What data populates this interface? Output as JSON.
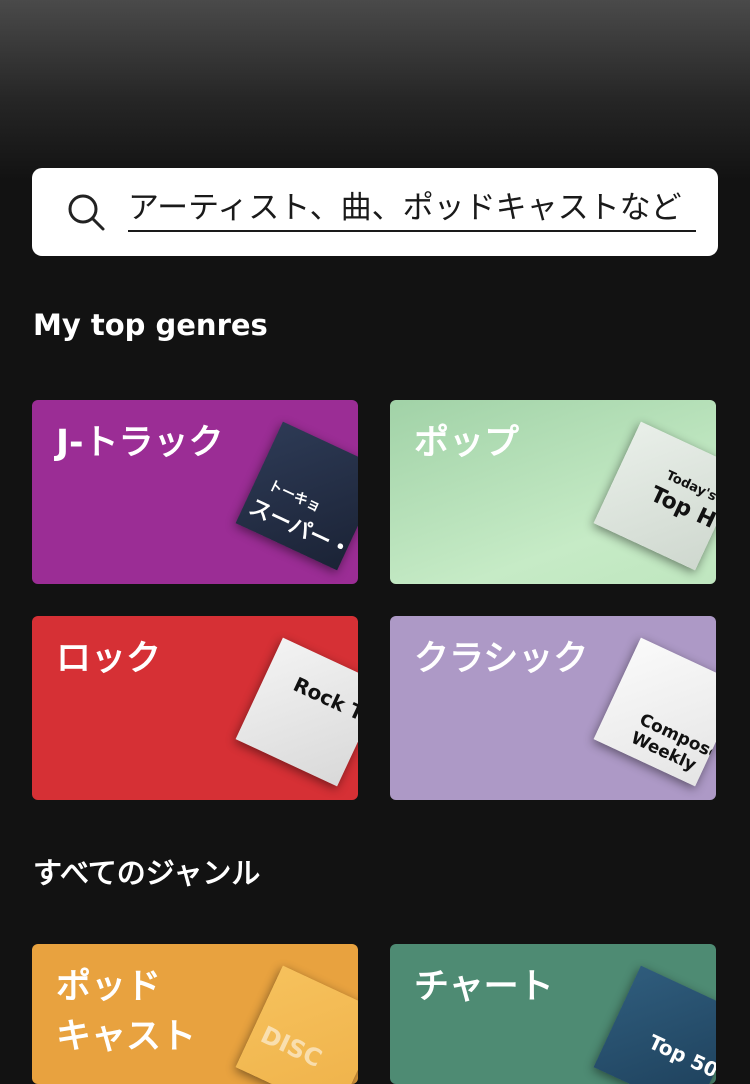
{
  "search": {
    "placeholder": "アーティスト、曲、ポッドキャストなど"
  },
  "sections": {
    "top_genres_title": "My top genres",
    "all_genres_title": "すべてのジャンル"
  },
  "top_genres": [
    {
      "label": "J-トラック",
      "color": "#9b2d95",
      "cover_text_1": "トーキョ",
      "cover_text_2": "スーパー・ヒ"
    },
    {
      "label": "ポップ",
      "color": "#a6d7ad",
      "cover_text_1": "Today's",
      "cover_text_2": "Top H"
    },
    {
      "label": "ロック",
      "color": "#d63035",
      "cover_text_1": "Rock T"
    },
    {
      "label": "クラシック",
      "color": "#ad99c6",
      "cover_text_1": "Composer",
      "cover_text_2": "Weekly"
    }
  ],
  "all_genres": [
    {
      "label": "ポッド\nキャスト",
      "color": "#e8a23f",
      "cover_text_1": "DISC"
    },
    {
      "label": "チャート",
      "color": "#4e8b73",
      "cover_text_1": "Top 50"
    }
  ]
}
